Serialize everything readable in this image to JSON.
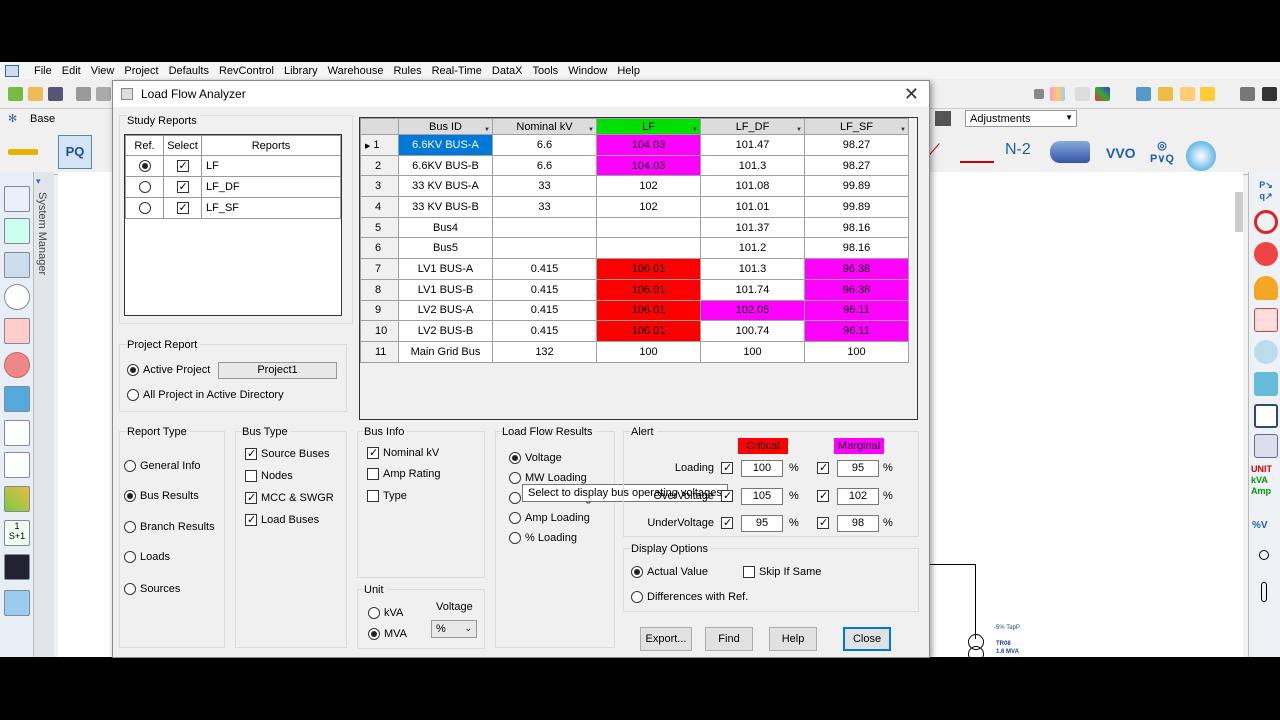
{
  "menu": [
    "File",
    "Edit",
    "View",
    "Project",
    "Defaults",
    "RevControl",
    "Library",
    "Warehouse",
    "Rules",
    "Real-Time",
    "DataX",
    "Tools",
    "Window",
    "Help"
  ],
  "toolbar": {
    "base_label": "Base",
    "adjustments_label": "Adjustments",
    "n2_label": "N-2",
    "vvo_label": "VVO"
  },
  "system_manager_label": "System Manager",
  "canvas": {
    "tap_label": "-5% TapP",
    "xfmr_name": "TR08",
    "xfmr_rating": "1.6 MVA"
  },
  "right_toolbar": {
    "unit_label": "UNIT",
    "kva_label": "kVA",
    "amp_label": "Amp",
    "pv_label": "%V"
  },
  "dialog": {
    "title": "Load Flow Analyzer",
    "study_reports": {
      "label": "Study Reports",
      "headers": [
        "Ref.",
        "Select",
        "Reports"
      ],
      "rows": [
        {
          "ref": true,
          "select": true,
          "name": "LF"
        },
        {
          "ref": false,
          "select": true,
          "name": "LF_DF"
        },
        {
          "ref": false,
          "select": true,
          "name": "LF_SF"
        }
      ]
    },
    "grid": {
      "headers": [
        "Bus ID",
        "Nominal kV",
        "LF",
        "LF_DF",
        "LF_SF"
      ],
      "rows": [
        {
          "n": "1",
          "bus": "6.6KV BUS-A",
          "kv": "6.6",
          "lf": "104.03",
          "lfdf": "101.47",
          "lfsf": "98.27",
          "c": [
            "sel",
            "",
            "pink",
            "",
            ""
          ],
          "current": true
        },
        {
          "n": "2",
          "bus": "6.6KV BUS-B",
          "kv": "6.6",
          "lf": "104.03",
          "lfdf": "101.3",
          "lfsf": "98.27",
          "c": [
            "",
            "",
            "pink",
            "",
            ""
          ]
        },
        {
          "n": "3",
          "bus": "33 KV BUS-A",
          "kv": "33",
          "lf": "102",
          "lfdf": "101.08",
          "lfsf": "99.89",
          "c": [
            "",
            "",
            "",
            "",
            ""
          ]
        },
        {
          "n": "4",
          "bus": "33 KV BUS-B",
          "kv": "33",
          "lf": "102",
          "lfdf": "101.01",
          "lfsf": "99.89",
          "c": [
            "",
            "",
            "",
            "",
            ""
          ]
        },
        {
          "n": "5",
          "bus": "Bus4",
          "kv": "",
          "lf": "",
          "lfdf": "101.37",
          "lfsf": "98.16",
          "c": [
            "",
            "",
            "",
            "",
            ""
          ]
        },
        {
          "n": "6",
          "bus": "Bus5",
          "kv": "",
          "lf": "",
          "lfdf": "101.2",
          "lfsf": "98.16",
          "c": [
            "",
            "",
            "",
            "",
            ""
          ]
        },
        {
          "n": "7",
          "bus": "LV1 BUS-A",
          "kv": "0.415",
          "lf": "106.01",
          "lfdf": "101.3",
          "lfsf": "96.38",
          "c": [
            "",
            "",
            "red",
            "",
            "pink"
          ]
        },
        {
          "n": "8",
          "bus": "LV1 BUS-B",
          "kv": "0.415",
          "lf": "106.01",
          "lfdf": "101.74",
          "lfsf": "96.38",
          "c": [
            "",
            "",
            "red",
            "",
            "pink"
          ]
        },
        {
          "n": "9",
          "bus": "LV2 BUS-A",
          "kv": "0.415",
          "lf": "106.01",
          "lfdf": "102.05",
          "lfsf": "96.11",
          "c": [
            "",
            "",
            "red",
            "pink",
            "pink"
          ]
        },
        {
          "n": "10",
          "bus": "LV2 BUS-B",
          "kv": "0.415",
          "lf": "106.01",
          "lfdf": "100.74",
          "lfsf": "96.11",
          "c": [
            "",
            "",
            "red",
            "",
            "pink"
          ]
        },
        {
          "n": "11",
          "bus": "Main Grid Bus",
          "kv": "132",
          "lf": "100",
          "lfdf": "100",
          "lfsf": "100",
          "c": [
            "",
            "",
            "",
            "",
            ""
          ]
        }
      ]
    },
    "project_report": {
      "label": "Project Report",
      "active_project_label": "Active Project",
      "active_project_value": "Project1",
      "all_projects_label": "All Project in Active Directory"
    },
    "report_type": {
      "label": "Report Type",
      "options": [
        "General Info",
        "Bus Results",
        "Branch Results",
        "Loads",
        "Sources"
      ],
      "selected": "Bus Results"
    },
    "bus_type": {
      "label": "Bus Type",
      "options": [
        {
          "label": "Source Buses",
          "checked": true
        },
        {
          "label": "Nodes",
          "checked": false
        },
        {
          "label": "MCC & SWGR",
          "checked": true
        },
        {
          "label": "Load Buses",
          "checked": true
        }
      ]
    },
    "bus_info": {
      "label": "Bus Info",
      "options": [
        {
          "label": "Nominal kV",
          "checked": true
        },
        {
          "label": "Amp Rating",
          "checked": false
        },
        {
          "label": "Type",
          "checked": false
        }
      ]
    },
    "unit": {
      "label": "Unit",
      "kva_label": "kVA",
      "mva_label": "MVA",
      "selected": "MVA",
      "voltage_label": "Voltage",
      "voltage_value": "%"
    },
    "load_flow_results": {
      "label": "Load Flow Results",
      "options": [
        "Voltage",
        "MW Loading",
        "Mvar Loading",
        "Amp Loading",
        "% Loading"
      ],
      "selected": "Voltage",
      "tooltip": "Select to display bus operating voltages"
    },
    "alert": {
      "label": "Alert",
      "critical_label": "Critical",
      "marginal_label": "Marginal",
      "critical_color": "#ff0000",
      "marginal_color": "#ff00ff",
      "rows": [
        {
          "label": "Loading",
          "crit_checked": true,
          "crit": "100",
          "marg_checked": true,
          "marg": "95"
        },
        {
          "label": "OverVoltage",
          "crit_checked": true,
          "crit": "105",
          "marg_checked": true,
          "marg": "102"
        },
        {
          "label": "UnderVoltage",
          "crit_checked": true,
          "crit": "95",
          "marg_checked": true,
          "marg": "98"
        }
      ],
      "percent": "%"
    },
    "display_options": {
      "label": "Display Options",
      "actual_label": "Actual Value",
      "skip_label": "Skip If Same",
      "diff_label": "Differences with Ref.",
      "selected": "Actual Value",
      "skip_checked": false
    },
    "buttons": {
      "export": "Export...",
      "find": "Find",
      "help": "Help",
      "close": "Close"
    }
  }
}
